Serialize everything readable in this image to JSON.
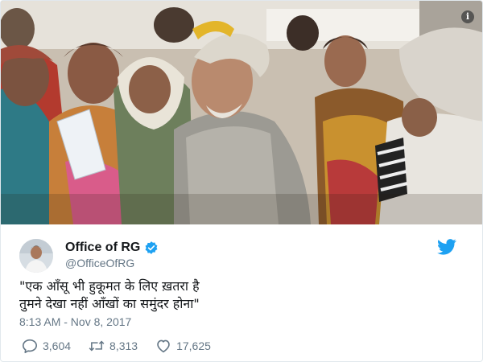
{
  "photo": {
    "alt_icon": "info-icon",
    "info_glyph": "i"
  },
  "tweet": {
    "display_name": "Office of RG",
    "handle": "@OfficeOfRG",
    "verified": true,
    "text_lines": [
      "\"एक आँसू भी हुकूमत के लिए ख़तरा है",
      "तुमने देखा नहीं आँखों का समुंदर होना\""
    ],
    "timestamp": "8:13 AM - Nov 8, 2017",
    "replies": "3,604",
    "retweets": "8,313",
    "likes": "17,625"
  },
  "colors": {
    "twitter_blue": "#1da1f2",
    "meta_gray": "#657786",
    "text": "#14171a"
  },
  "icons": [
    "info-icon",
    "verified-icon",
    "twitter-bird-icon",
    "reply-icon",
    "retweet-icon",
    "like-icon"
  ]
}
